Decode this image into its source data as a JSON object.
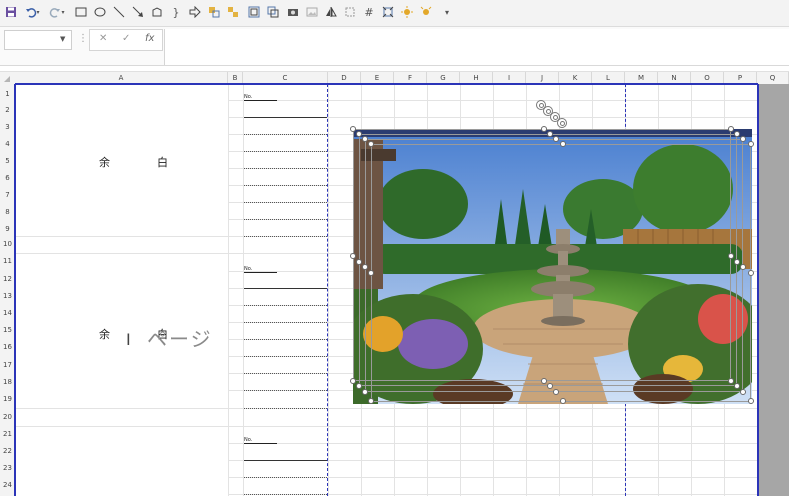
{
  "toolbar": {
    "icons": [
      "save-icon",
      "undo-icon",
      "redo-icon",
      "rectangle-icon",
      "ellipse-icon",
      "line-icon",
      "arrow-line-icon",
      "shape-icon",
      "bracket-icon",
      "block-arrow-icon",
      "group-icon",
      "ungroup-icon",
      "align-icon",
      "bring-forward-icon",
      "camera-icon",
      "image-icon",
      "flip-icon",
      "crop-icon",
      "resize-icon",
      "fit-icon",
      "effect-icon",
      "effect2-icon",
      "more-icon"
    ]
  },
  "formula_bar": {
    "name_box_value": "",
    "cancel_glyph": "✕",
    "confirm_glyph": "✓",
    "function_glyph": "fx",
    "separator_glyph": "⋮",
    "formula_value": ""
  },
  "columns": [
    "A",
    "B",
    "C",
    "D",
    "E",
    "F",
    "G",
    "H",
    "I",
    "J",
    "K",
    "L",
    "M",
    "N",
    "O",
    "P",
    "Q"
  ],
  "rows": [
    "1",
    "2",
    "3",
    "4",
    "5",
    "6",
    "7",
    "8",
    "9",
    "10",
    "11",
    "12",
    "13",
    "14",
    "15",
    "16",
    "17",
    "18",
    "19",
    "20",
    "21",
    "22",
    "23",
    "24"
  ],
  "cells": {
    "yohaku_1": "余　白",
    "yohaku_2": "余　白",
    "no_label": "No.",
    "page_watermark": "ページ"
  },
  "colors": {
    "page_break": "#2b34b8",
    "toolbar_bg": "#f3f3f3",
    "gutter": "#a6a6a6"
  },
  "image": {
    "description_icon": "garden-fountain-photo"
  }
}
